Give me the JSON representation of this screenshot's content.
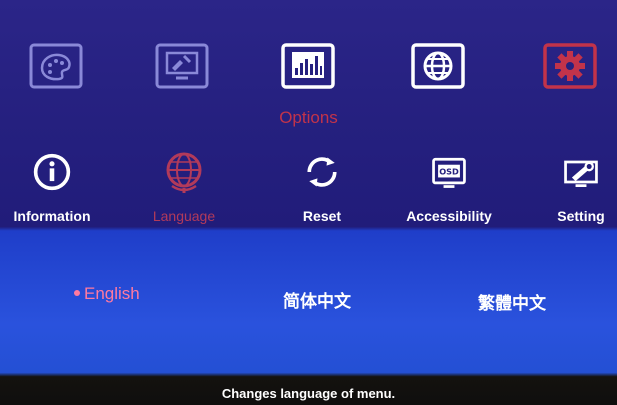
{
  "top_menu": {
    "category_label": "Options",
    "icons": [
      {
        "name": "palette-icon",
        "state": "inactive"
      },
      {
        "name": "display-tools-icon",
        "state": "inactive"
      },
      {
        "name": "options-icon",
        "state": "selected"
      },
      {
        "name": "globe-icon",
        "state": "inactive"
      },
      {
        "name": "gear-icon",
        "state": "highlighted"
      }
    ]
  },
  "sub_menu": {
    "items": [
      {
        "label": "Information",
        "icon": "info-icon"
      },
      {
        "label": "Language",
        "icon": "globe-icon",
        "active": true
      },
      {
        "label": "Reset",
        "icon": "reset-icon"
      },
      {
        "label": "Accessibility",
        "icon": "osd-icon"
      },
      {
        "label": "Setting",
        "icon": "setting-icon"
      }
    ]
  },
  "language_options": [
    {
      "label": "English",
      "selected": true
    },
    {
      "label": "简体中文",
      "selected": false
    },
    {
      "label": "繁體中文",
      "selected": false
    }
  ],
  "status_bar": {
    "text": "Changes language of menu."
  },
  "colors": {
    "accent": "#c2334a",
    "selected_text": "#ff7aa0",
    "panel_blue": "#2a52dd",
    "menu_bg": "#25207f"
  }
}
